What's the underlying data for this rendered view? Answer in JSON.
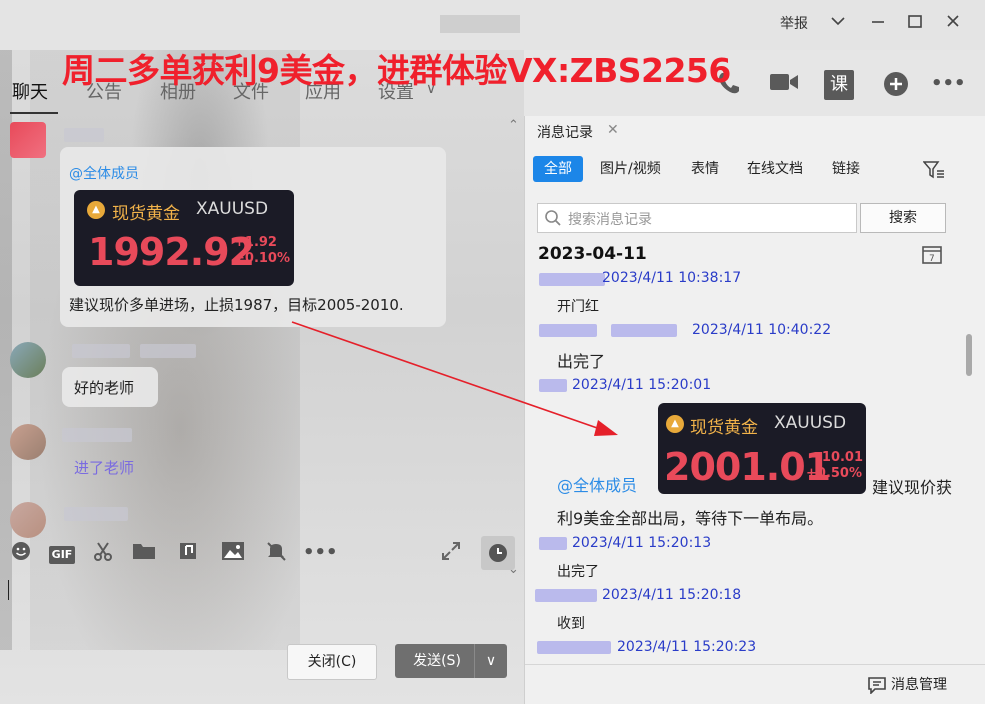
{
  "window": {
    "title": "",
    "controls": {
      "report": "举报",
      "dropdown": "∨",
      "minimize": "—",
      "maximize": "☐",
      "close": "✕"
    }
  },
  "overlay_title": "周二多单获利9美金，进群体验VX:ZBS2256",
  "nav": {
    "tabs": [
      "聊天",
      "公告",
      "相册",
      "文件",
      "应用",
      "设置"
    ]
  },
  "top_icons": {
    "call": "phone-icon",
    "video": "video-icon",
    "course": "课",
    "add": "add-icon",
    "more": "more-icon"
  },
  "chat": {
    "msg1": {
      "mention": "@全体成员",
      "card": {
        "name": "现货黄金",
        "symbol": "XAUUSD",
        "price": "1992.92",
        "change": "+1.92",
        "change_pct": "+0.10%"
      },
      "text": "建议现价多单进场，止损1987，目标2005-2010."
    },
    "msg2": {
      "text": "好的老师"
    },
    "msg3": {
      "text": "进了老师"
    }
  },
  "toolbar": {
    "icons": [
      "emoji-icon",
      "gif-icon",
      "scissors-icon",
      "folder-icon",
      "music-icon",
      "image-icon",
      "mute-icon",
      "more-icon"
    ],
    "gif_label": "GIF",
    "expand": "expand-icon",
    "history": "clock-icon"
  },
  "buttons": {
    "close": "关闭(C)",
    "send": "发送(S)"
  },
  "history": {
    "tab_label": "消息记录",
    "filters": [
      "全部",
      "图片/视频",
      "表情",
      "在线文档",
      "链接"
    ],
    "search_placeholder": "搜索消息记录",
    "search_button": "搜索",
    "date": "2023-04-11",
    "records": [
      {
        "time": "2023/4/11 10:38:17",
        "text": "开门红"
      },
      {
        "time": "2023/4/11 10:40:22",
        "text": "出完了"
      },
      {
        "time": "2023/4/11 15:20:01",
        "text": ""
      },
      {
        "time": "2023/4/11 15:20:13",
        "text": "出完了"
      },
      {
        "time": "2023/4/11 15:20:18",
        "text": "收到"
      },
      {
        "time": "2023/4/11 15:20:23",
        "text": ""
      }
    ],
    "card": {
      "mention": "@全体成员",
      "name": "现货黄金",
      "symbol": "XAUUSD",
      "price": "2001.01",
      "change": "+10.01",
      "change_pct": "+0.50%",
      "text_after": "建议现价获",
      "text_line2": "利9美金全部出局，等待下一单布局。"
    },
    "manage": "消息管理"
  },
  "colors": {
    "accent": "#1c86e8",
    "overlay": "#f0202c",
    "price": "#e84a5a",
    "gold": "#f2b34a",
    "time": "#2a3cc8"
  }
}
